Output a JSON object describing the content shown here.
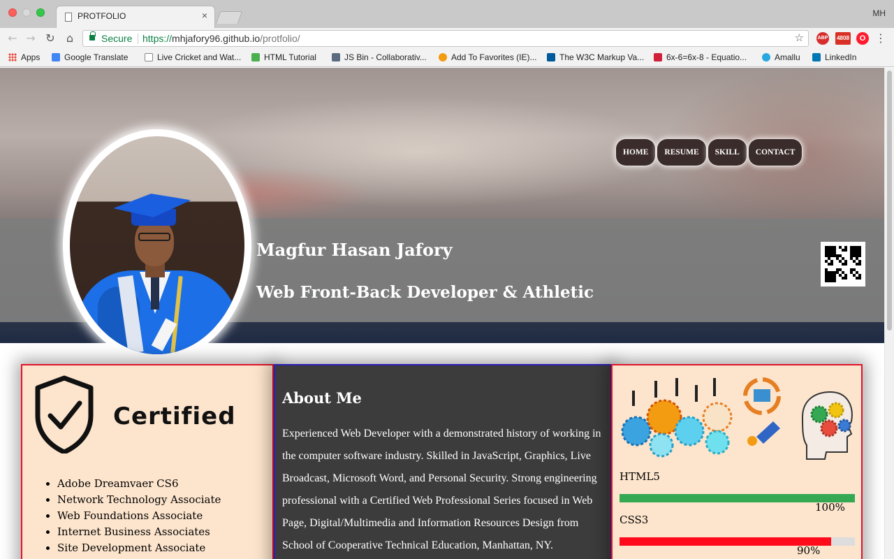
{
  "browser": {
    "tab_title": "PROTFOLIO",
    "tab_close": "×",
    "profile_initials": "MH",
    "secure_label": "Secure",
    "url_scheme": "https://",
    "url_host": "mhjafory96.github.io",
    "url_path": "/protfolio/",
    "ext_mail_count": "4808",
    "bookmarks": [
      {
        "label": "Apps"
      },
      {
        "label": "Google Translate"
      },
      {
        "label": "Live Cricket and Wat..."
      },
      {
        "label": "HTML Tutorial"
      },
      {
        "label": "JS Bin - Collaborativ..."
      },
      {
        "label": "Add To Favorites (IE)..."
      },
      {
        "label": "The W3C Markup Va..."
      },
      {
        "label": "6x-6=6x-8 - Equatio..."
      },
      {
        "label": "Amallu"
      },
      {
        "label": "LinkedIn"
      }
    ]
  },
  "header": {
    "nav": [
      "HOME",
      "RESUME",
      "SKILL",
      "CONTACT"
    ],
    "name": "Magfur Hasan Jafory",
    "role": "Web Front-Back Developer & Athletic"
  },
  "certified": {
    "logo_text": "Certified",
    "items": [
      "Adobe Dreamvaer CS6",
      "Network Technology Associate",
      "Web Foundations Associate",
      "Internet Business Associates",
      "Site Development Associate"
    ]
  },
  "about": {
    "title": "About Me",
    "text": "Experienced Web Developer with a demonstrated history of working in the computer software industry. Skilled in JavaScript, Graphics, Live Broadcast, Microsoft Word, and Personal Security. Strong engineering professional with a Certified Web Professional Series focused in Web Page, Digital/Multimedia and Information Resources Design from School of Cooperative Technical Education, Manhattan, NY."
  },
  "skills": [
    {
      "name": "HTML5",
      "percent_label": "100%",
      "level": 100,
      "color": "#34a853"
    },
    {
      "name": "CSS3",
      "percent_label": "90%",
      "level": 90,
      "color": "#ff0a1a"
    }
  ],
  "colors": {
    "card_border_red": "#e4122a",
    "card_border_blue": "#2c1eb6",
    "card_bg_peach": "#fde5cd",
    "about_bg": "#3c3c3c"
  }
}
